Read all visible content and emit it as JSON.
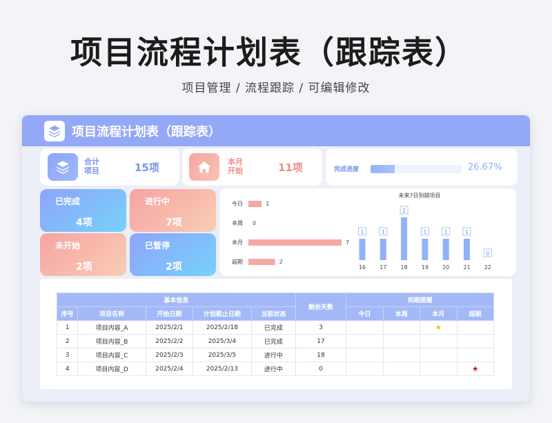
{
  "page": {
    "title": "项目流程计划表（跟踪表）",
    "subtitle": "项目管理 /  流程跟踪  /  可编辑修改"
  },
  "card": {
    "title": "项目流程计划表（跟踪表）",
    "header_icon": "layers-icon"
  },
  "summary": {
    "total": {
      "label_line1": "合计",
      "label_line2": "项目",
      "value": "15项",
      "icon": "layers-icon"
    },
    "month_start": {
      "label_line1": "本月",
      "label_line2": "开始",
      "value": "11项",
      "icon": "home-icon"
    },
    "progress": {
      "label": "完成进度",
      "value": "26.67%",
      "fraction": 0.2667
    }
  },
  "status_tiles": [
    {
      "label": "已完成",
      "value": "4项"
    },
    {
      "label": "进行中",
      "value": "7项"
    },
    {
      "label": "未开始",
      "value": "2项"
    },
    {
      "label": "已暂停",
      "value": "2项"
    }
  ],
  "colors": {
    "header": "#93a8f6",
    "blue_gradient": [
      "#8fa4fa",
      "#76d2fb"
    ],
    "pink_gradient": [
      "#f6a4a2",
      "#f8cdb5"
    ],
    "bar_pink": "#f4a9a4",
    "bar_blue": "#92b2f7",
    "star_gold": "#f2c22c",
    "star_red": "#e21818"
  },
  "chart_data": [
    {
      "type": "bar",
      "orientation": "horizontal",
      "categories": [
        "今日",
        "本周",
        "本月",
        "超期"
      ],
      "values": [
        1,
        0,
        7,
        2
      ],
      "xlim": [
        0,
        7
      ]
    },
    {
      "type": "bar",
      "title": "未来7日到期项目",
      "categories": [
        "16",
        "17",
        "18",
        "19",
        "20",
        "21",
        "22"
      ],
      "values": [
        1,
        1,
        2,
        1,
        1,
        1,
        0
      ],
      "ylim": [
        0,
        2
      ]
    }
  ],
  "table": {
    "group_basic": "基本信息",
    "group_remaining": "剩余天数",
    "group_due": "到期提醒",
    "headers": [
      "序号",
      "项目名称",
      "开始日期",
      "计划截止日期",
      "当前状态"
    ],
    "due_headers": [
      "今日",
      "本周",
      "本月",
      "超期"
    ],
    "rows": [
      {
        "no": "1",
        "name": "项目内容_A",
        "start": "2025/2/1",
        "deadline": "2025/2/18",
        "status": "已完成",
        "remaining": "3",
        "today": "",
        "week": "",
        "month": "★",
        "overdue": ""
      },
      {
        "no": "2",
        "name": "项目内容_B",
        "start": "2025/2/2",
        "deadline": "2025/3/4",
        "status": "已完成",
        "remaining": "17",
        "today": "",
        "week": "",
        "month": "",
        "overdue": ""
      },
      {
        "no": "3",
        "name": "项目内容_C",
        "start": "2025/2/3",
        "deadline": "2025/3/5",
        "status": "进行中",
        "remaining": "18",
        "today": "",
        "week": "",
        "month": "",
        "overdue": ""
      },
      {
        "no": "4",
        "name": "项目内容_D",
        "start": "2025/2/4",
        "deadline": "2025/2/13",
        "status": "进行中",
        "remaining": "0",
        "today": "",
        "week": "",
        "month": "",
        "overdue": "★"
      }
    ]
  }
}
